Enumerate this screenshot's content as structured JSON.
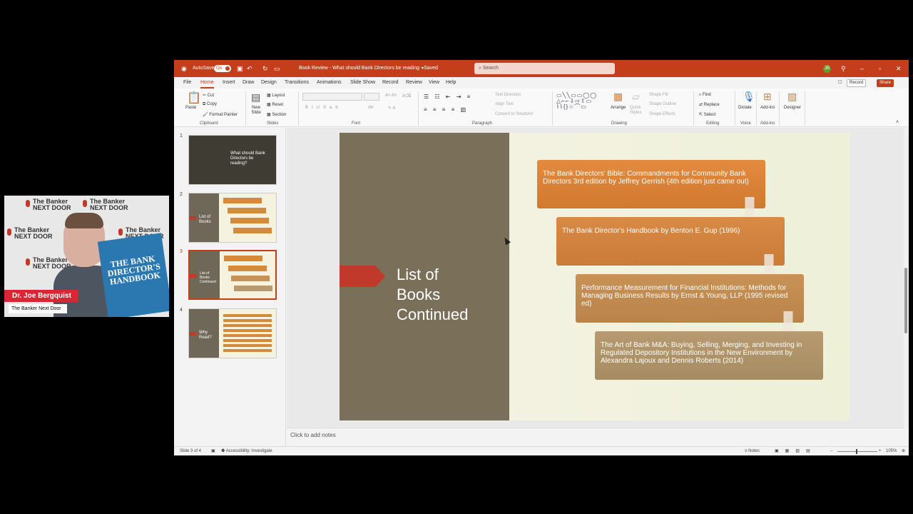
{
  "titlebar": {
    "autosave_label": "AutoSave",
    "toggle_label": "On",
    "doc_title": "Book Review - What should Bank Directors be reading - Saved",
    "search_placeholder": "Search"
  },
  "menu": {
    "tabs": [
      "File",
      "Home",
      "Insert",
      "Draw",
      "Design",
      "Transitions",
      "Animations",
      "Slide Show",
      "Record",
      "Review",
      "View",
      "Help"
    ],
    "record_label": "Record",
    "share_label": "Share"
  },
  "ribbon": {
    "paste": "Paste",
    "cut": "Cut",
    "copy": "Copy",
    "format_painter": "Format Painter",
    "clipboard": "Clipboard",
    "new_slide": "New Slide",
    "layout": "Layout",
    "reset": "Reset",
    "section": "Section",
    "slides": "Slides",
    "font": "Font",
    "paragraph": "Paragraph",
    "text_direction": "Text Direction",
    "align_text": "Align Text",
    "convert_smartart": "Convert to SmartArt",
    "arrange": "Arrange",
    "quick_styles": "Quick Styles",
    "shape_fill": "Shape Fill",
    "shape_outline": "Shape Outline",
    "shape_effects": "Shape Effects",
    "drawing": "Drawing",
    "find": "Find",
    "replace": "Replace",
    "select": "Select",
    "editing": "Editing",
    "dictate": "Dictate",
    "voice": "Voice",
    "addins": "Add-ins",
    "addins_group": "Add-ins",
    "designer": "Designer"
  },
  "thumbnails": [
    {
      "num": "1",
      "title": "What should Bank Directors be reading?"
    },
    {
      "num": "2",
      "title": "List of Books"
    },
    {
      "num": "3",
      "title": "List of Books Continued"
    },
    {
      "num": "4",
      "title": "Why Read?"
    }
  ],
  "slide": {
    "title": "List of\nBooks\nContinued",
    "books": [
      "The Bank Directors' Bible: Commandments for Community Bank Directors 3rd edition by Jeffrey Gerrish (4th edition just came out)",
      "The Bank Director's Handbook by Benton E. Gup (1996)",
      "Performance Measurement for Financial Institutions: Methods for Managing Business Results by Ernst & Young, LLP (1995 revised ed)",
      "The Art of Bank M&A: Buying, Selling, Merging, and Investing in Regulated Depository Institutions in the New Environment by Alexandra Lajoux and Dennis Roberts (2014)"
    ]
  },
  "notes_placeholder": "Click to add notes",
  "status": {
    "slide_count": "Slide 3 of 4",
    "accessibility": "Accessibility: Investigate",
    "notes": "Notes",
    "zoom": "105%"
  },
  "webcam": {
    "brand": "The Banker NEXT DOOR",
    "name": "Dr. Joe Bergquist",
    "show": "The Banker Next Door",
    "book_cover": "THE BANK DIRECTOR'S HANDBOOK"
  },
  "colors": {
    "accent": "#c43e1c",
    "slide_dark": "#7a6f58",
    "arrow_red": "#c0392b"
  }
}
